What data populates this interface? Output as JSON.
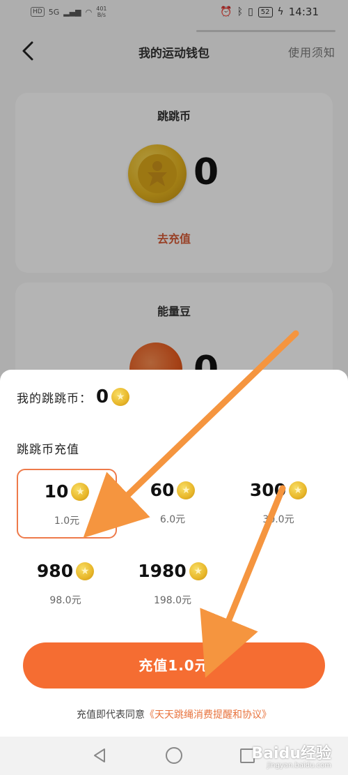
{
  "status_bar": {
    "hd": "HD",
    "signal": "5G",
    "net_speed": "401",
    "net_unit": "B/s",
    "battery": "52",
    "time": "14:31"
  },
  "header": {
    "title": "我的运动钱包",
    "usage_link": "使用须知"
  },
  "coin_card": {
    "title": "跳跳币",
    "value": "0",
    "recharge_link": "去充值"
  },
  "bean_card": {
    "title": "能量豆",
    "value": "0"
  },
  "sheet": {
    "my_coins_label": "我的跳跳币：",
    "my_coins_value": "0",
    "section_label": "跳跳币充值",
    "options": [
      {
        "amount": "10",
        "price": "1.0元",
        "selected": true
      },
      {
        "amount": "60",
        "price": "6.0元",
        "selected": false
      },
      {
        "amount": "300",
        "price": "30.0元",
        "selected": false
      },
      {
        "amount": "980",
        "price": "98.0元",
        "selected": false
      },
      {
        "amount": "1980",
        "price": "198.0元",
        "selected": false
      }
    ],
    "recharge_button": "充值1.0元",
    "agreement_prefix": "充值即代表同意",
    "agreement_link": "《天天跳绳消费提醒和协议》"
  },
  "watermark": {
    "text": "Baidu经验",
    "sub": "jingyan.baidu.com"
  },
  "colors": {
    "accent": "#f56d32",
    "selected_border": "#ee7a4a",
    "link": "#e8733d",
    "coin_gold": "#e8b72a",
    "annotation_arrow": "#f5953f"
  }
}
